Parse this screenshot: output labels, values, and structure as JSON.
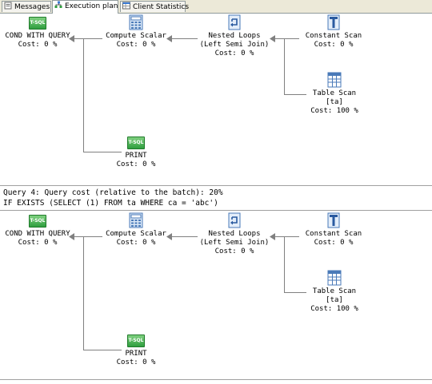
{
  "tabs": [
    {
      "label": "Messages",
      "icon": "messages-icon"
    },
    {
      "label": "Execution plan",
      "icon": "execution-plan-icon",
      "active": true
    },
    {
      "label": "Client Statistics",
      "icon": "client-statistics-icon"
    }
  ],
  "plan1": {
    "cond": {
      "title": "COND WITH QUERY",
      "cost": "Cost: 0 %",
      "badge": "T-SQL"
    },
    "compute": {
      "title": "Compute Scalar",
      "cost": "Cost: 0 %"
    },
    "nested": {
      "title": "Nested Loops",
      "subtitle": "(Left Semi Join)",
      "cost": "Cost: 0 %"
    },
    "constant": {
      "title": "Constant Scan",
      "cost": "Cost: 0 %"
    },
    "table": {
      "title": "Table Scan",
      "subtitle": "[ta]",
      "cost": "Cost: 100 %"
    },
    "print": {
      "title": "PRINT",
      "cost": "Cost: 0 %",
      "badge": "T-SQL"
    }
  },
  "query": {
    "header": "Query 4: Query cost (relative to the batch): 20%",
    "text": "IF EXISTS (SELECT (1) FROM ta WHERE ca = 'abc')"
  },
  "plan2": {
    "cond": {
      "title": "COND WITH QUERY",
      "cost": "Cost: 0 %",
      "badge": "T-SQL"
    },
    "compute": {
      "title": "Compute Scalar",
      "cost": "Cost: 0 %"
    },
    "nested": {
      "title": "Nested Loops",
      "subtitle": "(Left Semi Join)",
      "cost": "Cost: 0 %"
    },
    "constant": {
      "title": "Constant Scan",
      "cost": "Cost: 0 %"
    },
    "table": {
      "title": "Table Scan",
      "subtitle": "[ta]",
      "cost": "Cost: 100 %"
    },
    "print": {
      "title": "PRINT",
      "cost": "Cost: 0 %",
      "badge": "T-SQL"
    }
  }
}
